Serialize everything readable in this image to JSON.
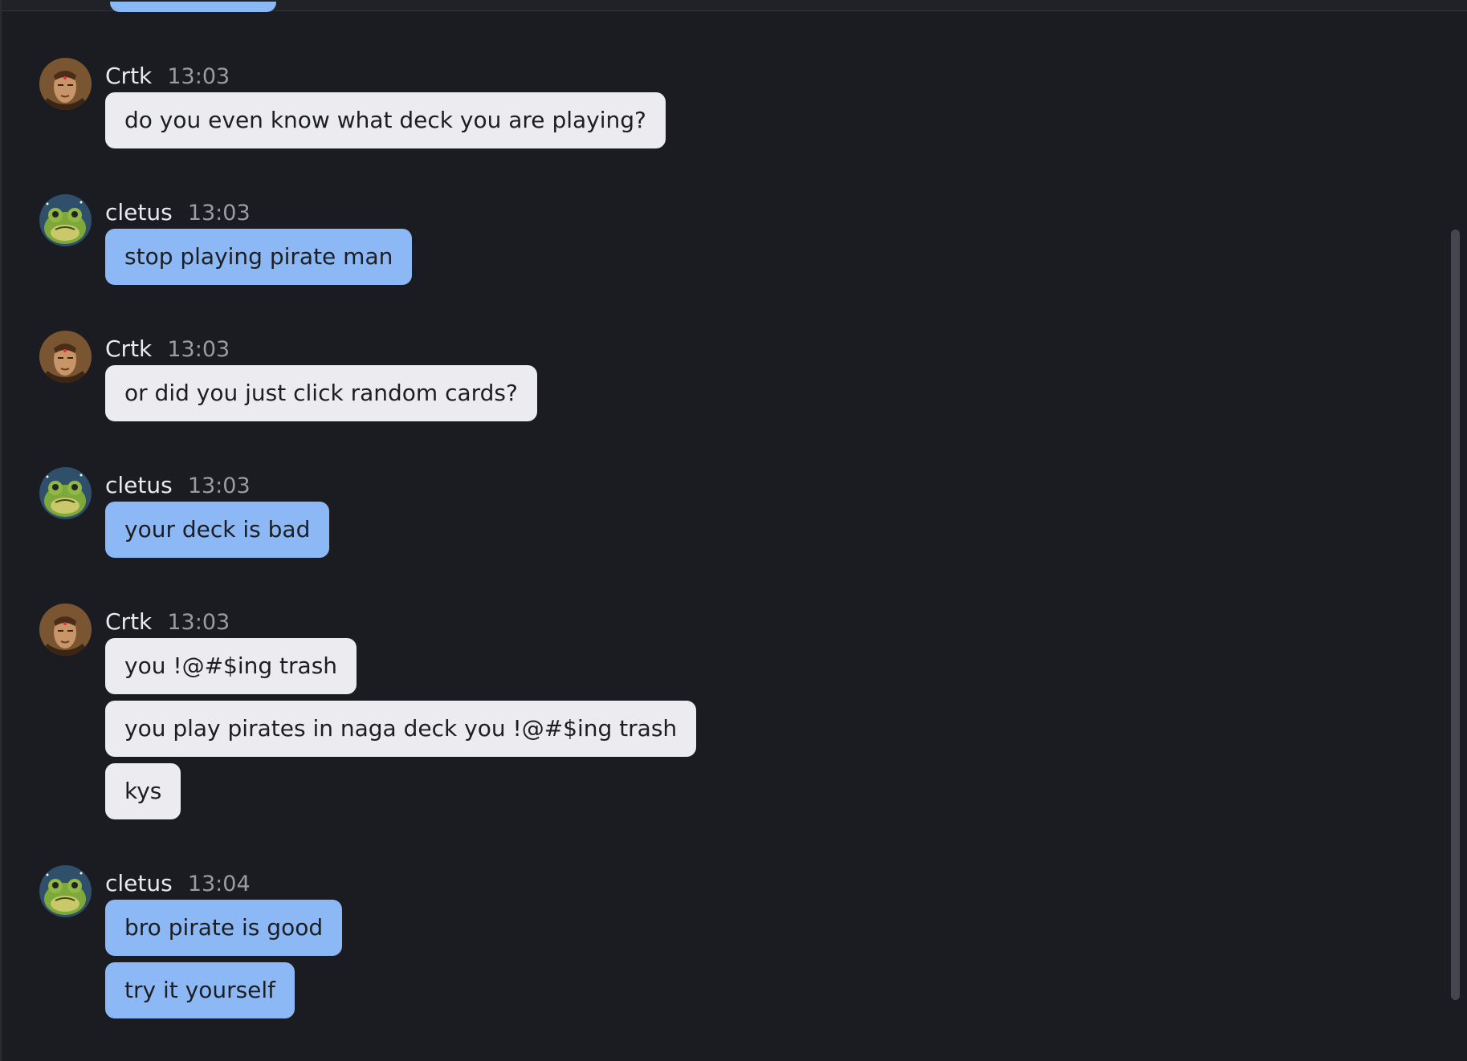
{
  "colors": {
    "background": "#1b1c21",
    "bubble_other": "#ececf0",
    "bubble_self": "#8cb9f6",
    "name_text": "#e9eaee",
    "time_text": "#9a9ca4",
    "scrollbar_thumb": "#45474e"
  },
  "messages": [
    {
      "sender": "Crtk",
      "time": "13:03",
      "avatar": "warrior-avatar-icon",
      "texts": [
        "do you even know what deck you are playing?"
      ]
    },
    {
      "sender": "cletus",
      "time": "13:03",
      "avatar": "frog-avatar-icon",
      "texts": [
        "stop playing pirate man"
      ]
    },
    {
      "sender": "Crtk",
      "time": "13:03",
      "avatar": "warrior-avatar-icon",
      "texts": [
        "or did you just click random cards?"
      ]
    },
    {
      "sender": "cletus",
      "time": "13:03",
      "avatar": "frog-avatar-icon",
      "texts": [
        "your deck is bad"
      ]
    },
    {
      "sender": "Crtk",
      "time": "13:03",
      "avatar": "warrior-avatar-icon",
      "texts": [
        "you !@#$ing trash",
        "you play pirates in naga deck you !@#$ing trash",
        "kys"
      ]
    },
    {
      "sender": "cletus",
      "time": "13:04",
      "avatar": "frog-avatar-icon",
      "texts": [
        "bro pirate is good",
        "try it yourself"
      ]
    }
  ]
}
